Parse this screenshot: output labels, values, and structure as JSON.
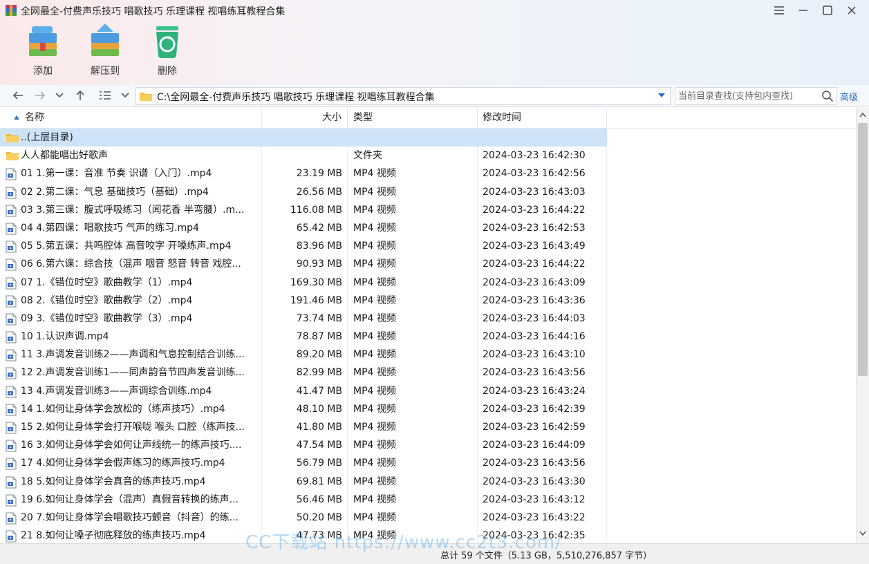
{
  "window": {
    "title": "全网最全-付费声乐技巧 唱歌技巧 乐理课程 视唱练耳教程合集",
    "controls": [
      "menu-icon",
      "minimize-icon",
      "maximize-icon",
      "close-icon"
    ]
  },
  "toolbar": {
    "add_label": "添加",
    "extract_label": "解压到",
    "delete_label": "删除"
  },
  "address": {
    "path": "C:\\全网最全-付费声乐技巧 唱歌技巧 乐理课程 视唱练耳教程合集",
    "search_placeholder": "当前目录查找(支持包内查找)",
    "advanced_label": "高级"
  },
  "columns": {
    "name": "名称",
    "size": "大小",
    "type": "类型",
    "modified": "修改时间"
  },
  "files": [
    {
      "name": "..(上层目录)",
      "size": "",
      "type": "",
      "modified": "",
      "icon": "folder-icon"
    },
    {
      "name": "人人都能唱出好歌声",
      "size": "",
      "type": "文件夹",
      "modified": "2024-03-23 16:42:30",
      "icon": "folder-icon"
    },
    {
      "name": "01 1.第一课：音准 节奏 识谱（入门）.mp4",
      "size": "23.19 MB",
      "type": "MP4 视频",
      "modified": "2024-03-23 16:42:56",
      "icon": "video-file-icon"
    },
    {
      "name": "02 2.第二课：气息 基础技巧（基础）.mp4",
      "size": "26.56 MB",
      "type": "MP4 视频",
      "modified": "2024-03-23 16:43:03",
      "icon": "video-file-icon"
    },
    {
      "name": "03 3.第三课：腹式呼吸练习（闻花香 半弯腰）.m...",
      "size": "116.08 MB",
      "type": "MP4 视频",
      "modified": "2024-03-23 16:44:22",
      "icon": "video-file-icon"
    },
    {
      "name": "04 4.第四课：唱歌技巧 气声的练习.mp4",
      "size": "65.42 MB",
      "type": "MP4 视频",
      "modified": "2024-03-23 16:42:53",
      "icon": "video-file-icon"
    },
    {
      "name": "05 5.第五课：共鸣腔体 高音咬字 开嗓练声.mp4",
      "size": "83.96 MB",
      "type": "MP4 视频",
      "modified": "2024-03-23 16:43:49",
      "icon": "video-file-icon"
    },
    {
      "name": "06 6.第六课：综合技（混声 咽音 怒音 转音 戏腔...",
      "size": "90.93 MB",
      "type": "MP4 视频",
      "modified": "2024-03-23 16:44:22",
      "icon": "video-file-icon"
    },
    {
      "name": "07 1.《错位时空》歌曲教学（1）.mp4",
      "size": "169.30 MB",
      "type": "MP4 视频",
      "modified": "2024-03-23 16:43:09",
      "icon": "video-file-icon"
    },
    {
      "name": "08 2.《错位时空》歌曲教学（2）.mp4",
      "size": "191.46 MB",
      "type": "MP4 视频",
      "modified": "2024-03-23 16:43:36",
      "icon": "video-file-icon"
    },
    {
      "name": "09 3.《错位时空》歌曲教学（3）.mp4",
      "size": "73.74 MB",
      "type": "MP4 视频",
      "modified": "2024-03-23 16:44:03",
      "icon": "video-file-icon"
    },
    {
      "name": "10 1.认识声调.mp4",
      "size": "78.87 MB",
      "type": "MP4 视频",
      "modified": "2024-03-23 16:44:16",
      "icon": "video-file-icon"
    },
    {
      "name": "11 3.声调发音训练2——声调和气息控制结合训练...",
      "size": "89.20 MB",
      "type": "MP4 视频",
      "modified": "2024-03-23 16:43:10",
      "icon": "video-file-icon"
    },
    {
      "name": "12 2.声调发音训练1——同声韵音节四声发音训练...",
      "size": "82.99 MB",
      "type": "MP4 视频",
      "modified": "2024-03-23 16:43:56",
      "icon": "video-file-icon"
    },
    {
      "name": "13 4.声调发音训练3——声调综合训练.mp4",
      "size": "41.47 MB",
      "type": "MP4 视频",
      "modified": "2024-03-23 16:43:24",
      "icon": "video-file-icon"
    },
    {
      "name": "14 1.如何让身体学会放松的（练声技巧）.mp4",
      "size": "48.10 MB",
      "type": "MP4 视频",
      "modified": "2024-03-23 16:42:39",
      "icon": "video-file-icon"
    },
    {
      "name": "15 2.如何让身体学会打开喉咙 喉头 口腔（练声技...",
      "size": "41.80 MB",
      "type": "MP4 视频",
      "modified": "2024-03-23 16:42:59",
      "icon": "video-file-icon"
    },
    {
      "name": "16 3.如何让身体学会如何让声线统一的练声技巧....",
      "size": "47.54 MB",
      "type": "MP4 视频",
      "modified": "2024-03-23 16:44:09",
      "icon": "video-file-icon"
    },
    {
      "name": "17 4.如何让身体学会假声练习的练声技巧.mp4",
      "size": "56.79 MB",
      "type": "MP4 视频",
      "modified": "2024-03-23 16:43:56",
      "icon": "video-file-icon"
    },
    {
      "name": "18 5.如何让身体学会真音的练声技巧.mp4",
      "size": "69.81 MB",
      "type": "MP4 视频",
      "modified": "2024-03-23 16:43:30",
      "icon": "video-file-icon"
    },
    {
      "name": "19 6.如何让身体学会（混声）真假音转换的练声...",
      "size": "56.46 MB",
      "type": "MP4 视频",
      "modified": "2024-03-23 16:43:12",
      "icon": "video-file-icon"
    },
    {
      "name": "20 7.如何让身体学会唱歌技巧颤音（抖音）的练...",
      "size": "50.20 MB",
      "type": "MP4 视频",
      "modified": "2024-03-23 16:43:22",
      "icon": "video-file-icon"
    },
    {
      "name": "21 8.如何让嗓子彻底释放的练声技巧.mp4",
      "size": "47.73 MB",
      "type": "MP4 视频",
      "modified": "2024-03-23 16:42:35",
      "icon": "video-file-icon"
    }
  ],
  "status": {
    "summary": "总计 59 个文件（5.13 GB，5,510,276,857 字节）"
  },
  "watermark": "CC下载站 https://www.cc2t3.com/",
  "colors": {
    "selection": "#cfe3f8",
    "accent": "#2a6fc9",
    "folder": "#f3c04a"
  }
}
